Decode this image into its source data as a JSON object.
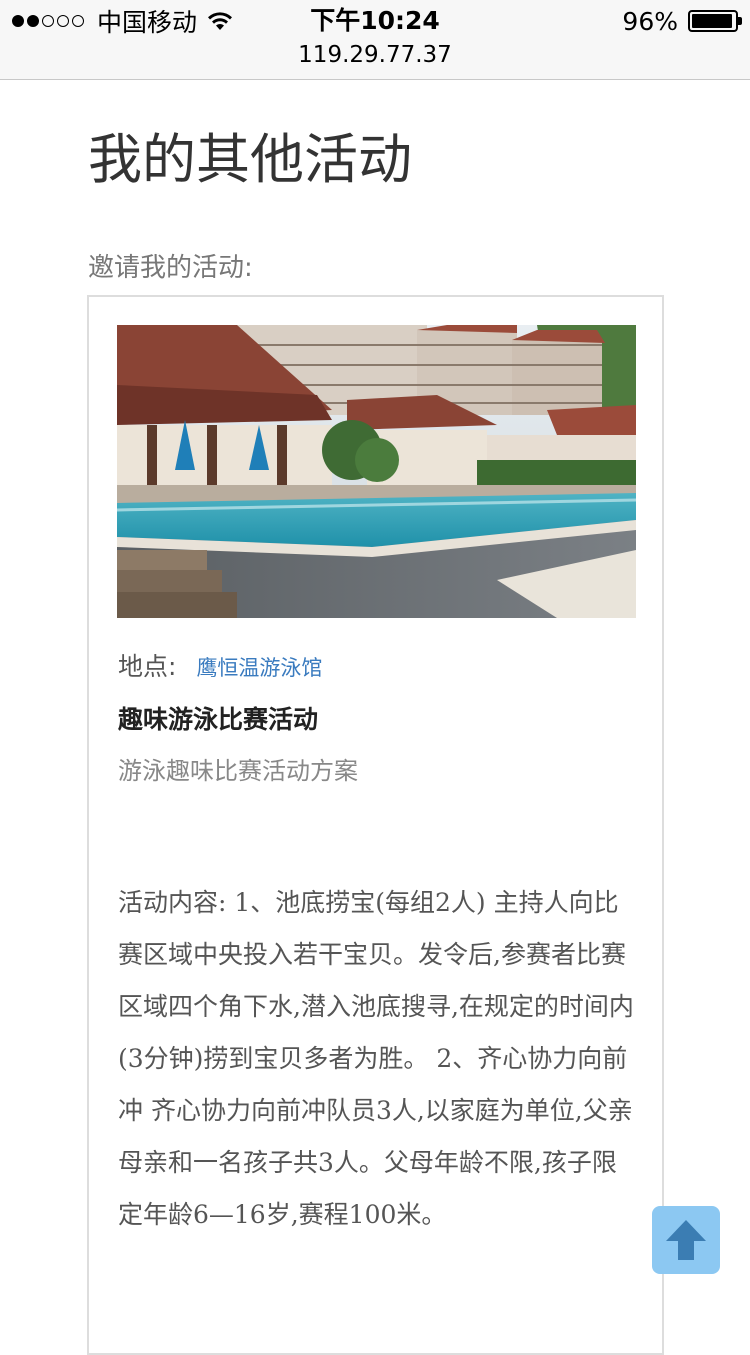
{
  "status_bar": {
    "carrier": "中国移动",
    "time": "下午10:24",
    "battery_text": "96%",
    "battery_level": 0.96,
    "signal_bars_filled": 2,
    "signal_bars_total": 5,
    "url": "119.29.77.37"
  },
  "page": {
    "title": "我的其他活动",
    "section_label": "邀请我的活动:"
  },
  "activity": {
    "location_label": "地点:",
    "location_name": "鹰恒温游泳馆",
    "title": "趣味游泳比赛活动",
    "subtitle": "游泳趣味比赛活动方案",
    "body": "活动内容: 1、池底捞宝(每组2人) 主持人向比赛区域中央投入若干宝贝。发令后,参赛者比赛区域四个角下水,潜入池底搜寻,在规定的时间内(3分钟)捞到宝贝多者为胜。 2、齐心协力向前冲 齐心协力向前冲队员3人,以家庭为单位,父亲母亲和一名孩子共3人。父母年龄不限,孩子限定年龄6—16岁,赛程100米。"
  },
  "icons": {
    "back_to_top": "arrow-up-icon",
    "wifi": "wifi-icon",
    "battery": "battery-icon"
  },
  "colors": {
    "link": "#3a7bbf",
    "back_to_top_bg": "#8cc8f2"
  }
}
